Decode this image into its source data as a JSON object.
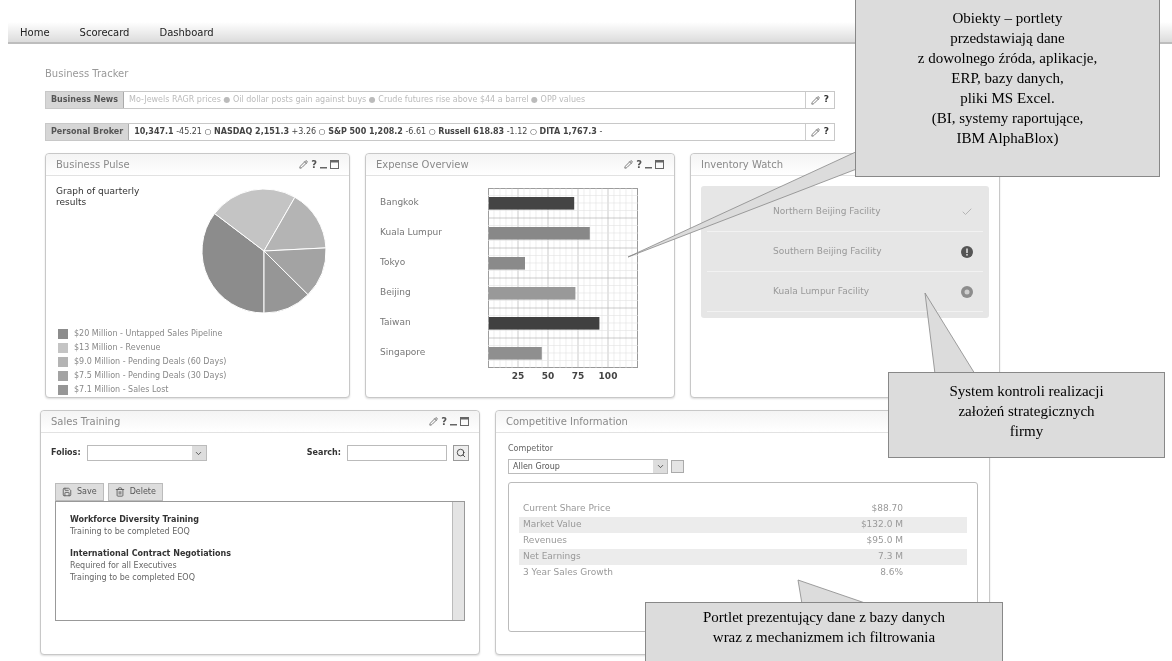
{
  "nav": {
    "tabs": [
      {
        "label": "Home"
      },
      {
        "label": "Scorecard"
      },
      {
        "label": "Dashboard"
      }
    ]
  },
  "business_tracker": {
    "title": "Business Tracker",
    "tickers": [
      {
        "label": "Business News",
        "text": "Mo-Jewels RAGR prices ● Oil dollar posts gain against buys ● Crude futures rise above $44 a barrel ● OPP values",
        "help": "?"
      },
      {
        "label": "Personal Broker",
        "text": "**10,347.1** -45.21 ○ **NASDAQ 2,151.3** +3.26 ○ **S&P 500 1,208.2** -6.61 ○ **Russell 618.83** -1.12 ○ **DITA 1,767.3** -",
        "help": "?"
      }
    ]
  },
  "business_pulse": {
    "title": "Business Pulse",
    "help": "?",
    "subtitle": "Graph of quarterly results",
    "chart_data": {
      "type": "pie",
      "categories": [
        "$20 Million - Untapped Sales Pipeline",
        "$13 Million - Revenue",
        "$9.0 Million - Pending Deals (60 Days)",
        "$7.5 Million - Pending Deals (30 Days)",
        "$7.1 Million - Sales Lost"
      ],
      "values": [
        20,
        13,
        9,
        7.5,
        7.1
      ],
      "colors": [
        "#8c8c8c",
        "#c4c4c4",
        "#b4b4b4",
        "#a3a3a3",
        "#969696"
      ]
    }
  },
  "expense_overview": {
    "title": "Expense Overview",
    "help": "?",
    "chart_data": {
      "type": "bar",
      "orientation": "horizontal",
      "categories": [
        "Bangkok",
        "Kuala Lumpur",
        "Tokyo",
        "Beijing",
        "Taiwan",
        "Singapore"
      ],
      "values": [
        71,
        84,
        30,
        72,
        92,
        44
      ],
      "colors": [
        "#444444",
        "#888888",
        "#8a8a8a",
        "#999999",
        "#404040",
        "#8f8f8f"
      ],
      "xlim": [
        0,
        125
      ],
      "xticks": [
        25,
        50,
        75,
        100
      ],
      "grid": true
    }
  },
  "inventory_watch": {
    "title": "Inventory Watch",
    "items": [
      {
        "label": "Northern Beijing Facility",
        "kind": "ok"
      },
      {
        "label": "Southern Beijing Facility",
        "kind": "alert"
      },
      {
        "label": "Kuala Lumpur Facility",
        "kind": "pending"
      }
    ]
  },
  "sales_training": {
    "title": "Sales Training",
    "help": "?",
    "folios_label": "Folios:",
    "search_label": "Search:",
    "buttons": [
      {
        "label": "Save",
        "kind": "save"
      },
      {
        "label": "Delete",
        "kind": "delete"
      }
    ],
    "entries": [
      {
        "title": "Workforce Diversity Training",
        "lines": [
          "Training to be completed EOQ"
        ]
      },
      {
        "title": "International Contract Negotiations",
        "lines": [
          "Required for all Executives",
          "Trainging to be completed EOQ"
        ]
      }
    ]
  },
  "competitive_information": {
    "title": "Competitive Information",
    "competitor_label": "Competitor",
    "competitor": "Allen Group",
    "rows": [
      {
        "label": "Current Share Price",
        "value": "$88.70"
      },
      {
        "label": "Market Value",
        "value": "$132.0 M"
      },
      {
        "label": "Revenues",
        "value": "$95.0 M"
      },
      {
        "label": "Net Earnings",
        "value": "7.3 M"
      },
      {
        "label": "3 Year Sales Growth",
        "value": "8.6%"
      }
    ]
  },
  "callouts": [
    {
      "text": "Obiekty – portlety\nprzedstawiają dane\nz dowolnego źróda, aplikacje,\nERP, bazy danych,\npliki MS Excel.\n(BI, systemy raportujące,\nIBM AlphaBlox)"
    },
    {
      "text": "System kontroli realizacji\nzałożeń strategicznych\nfirmy"
    },
    {
      "text": "Portlet prezentujący dane z bazy danych\nwraz z mechanizmem ich filtrowania"
    }
  ]
}
